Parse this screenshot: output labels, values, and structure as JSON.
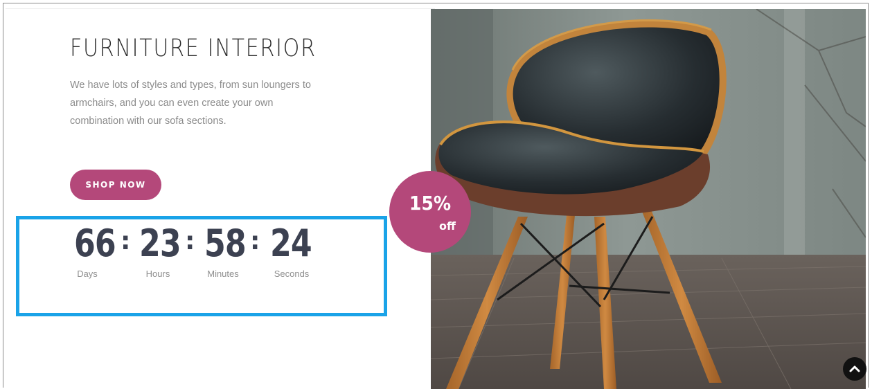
{
  "hero": {
    "title": "FURNITURE INTERIOR",
    "description_lines": [
      "We have lots of styles and types, from sun loungers to",
      "armchairs, and you can even create your own",
      "combination with our sofa sections."
    ],
    "shop_button_label": "SHOP NOW"
  },
  "countdown": {
    "days": {
      "value": "66",
      "label": "Days"
    },
    "hours": {
      "value": "23",
      "label": "Hours"
    },
    "minutes": {
      "value": "58",
      "label": "Minutes"
    },
    "seconds": {
      "value": "24",
      "label": "Seconds"
    },
    "separator": ":"
  },
  "badge": {
    "percent": "15%",
    "suffix": "off"
  },
  "icons": {
    "scroll_top": "chevron-up-icon"
  },
  "colors": {
    "accent": "#b4487a",
    "highlight_border": "#1aa3e8",
    "countdown_text": "#3c4151"
  }
}
